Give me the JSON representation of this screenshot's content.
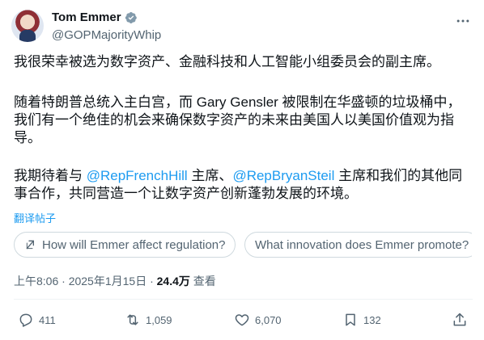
{
  "author": {
    "display_name": "Tom Emmer",
    "handle": "@GOPMajorityWhip"
  },
  "tweet": {
    "paragraph1": "我很荣幸被选为数字资产、金融科技和人工智能小组委员会的副主席。",
    "paragraph2": "随着特朗普总统入主白宫，而 Gary Gensler 被限制在华盛顿的垃圾桶中，我们有一个绝佳的机会来确保数字资产的未来由美国人以美国价值观为指导。",
    "paragraph3_pre": "我期待着与 ",
    "mention1": "@RepFrenchHill",
    "paragraph3_mid": " 主席、",
    "mention2": "@RepBryanSteil",
    "paragraph3_post": " 主席和我们的其他同事合作，共同营造一个让数字资产创新蓬勃发展的环境。"
  },
  "translate_label": "翻译帖子",
  "chips": [
    {
      "label": "How will Emmer affect regulation?",
      "icon": "grok-icon"
    },
    {
      "label": "What innovation does Emmer promote?"
    }
  ],
  "meta": {
    "time": "上午8:06 · 2025年1月15日 · ",
    "views": "24.4万",
    "views_label": " 查看"
  },
  "actions": {
    "replies": "411",
    "retweets": "1,059",
    "likes": "6,070",
    "bookmarks": "132"
  },
  "colors": {
    "link": "#1d9bf0",
    "secondary": "#536471",
    "text": "#0f1419"
  }
}
